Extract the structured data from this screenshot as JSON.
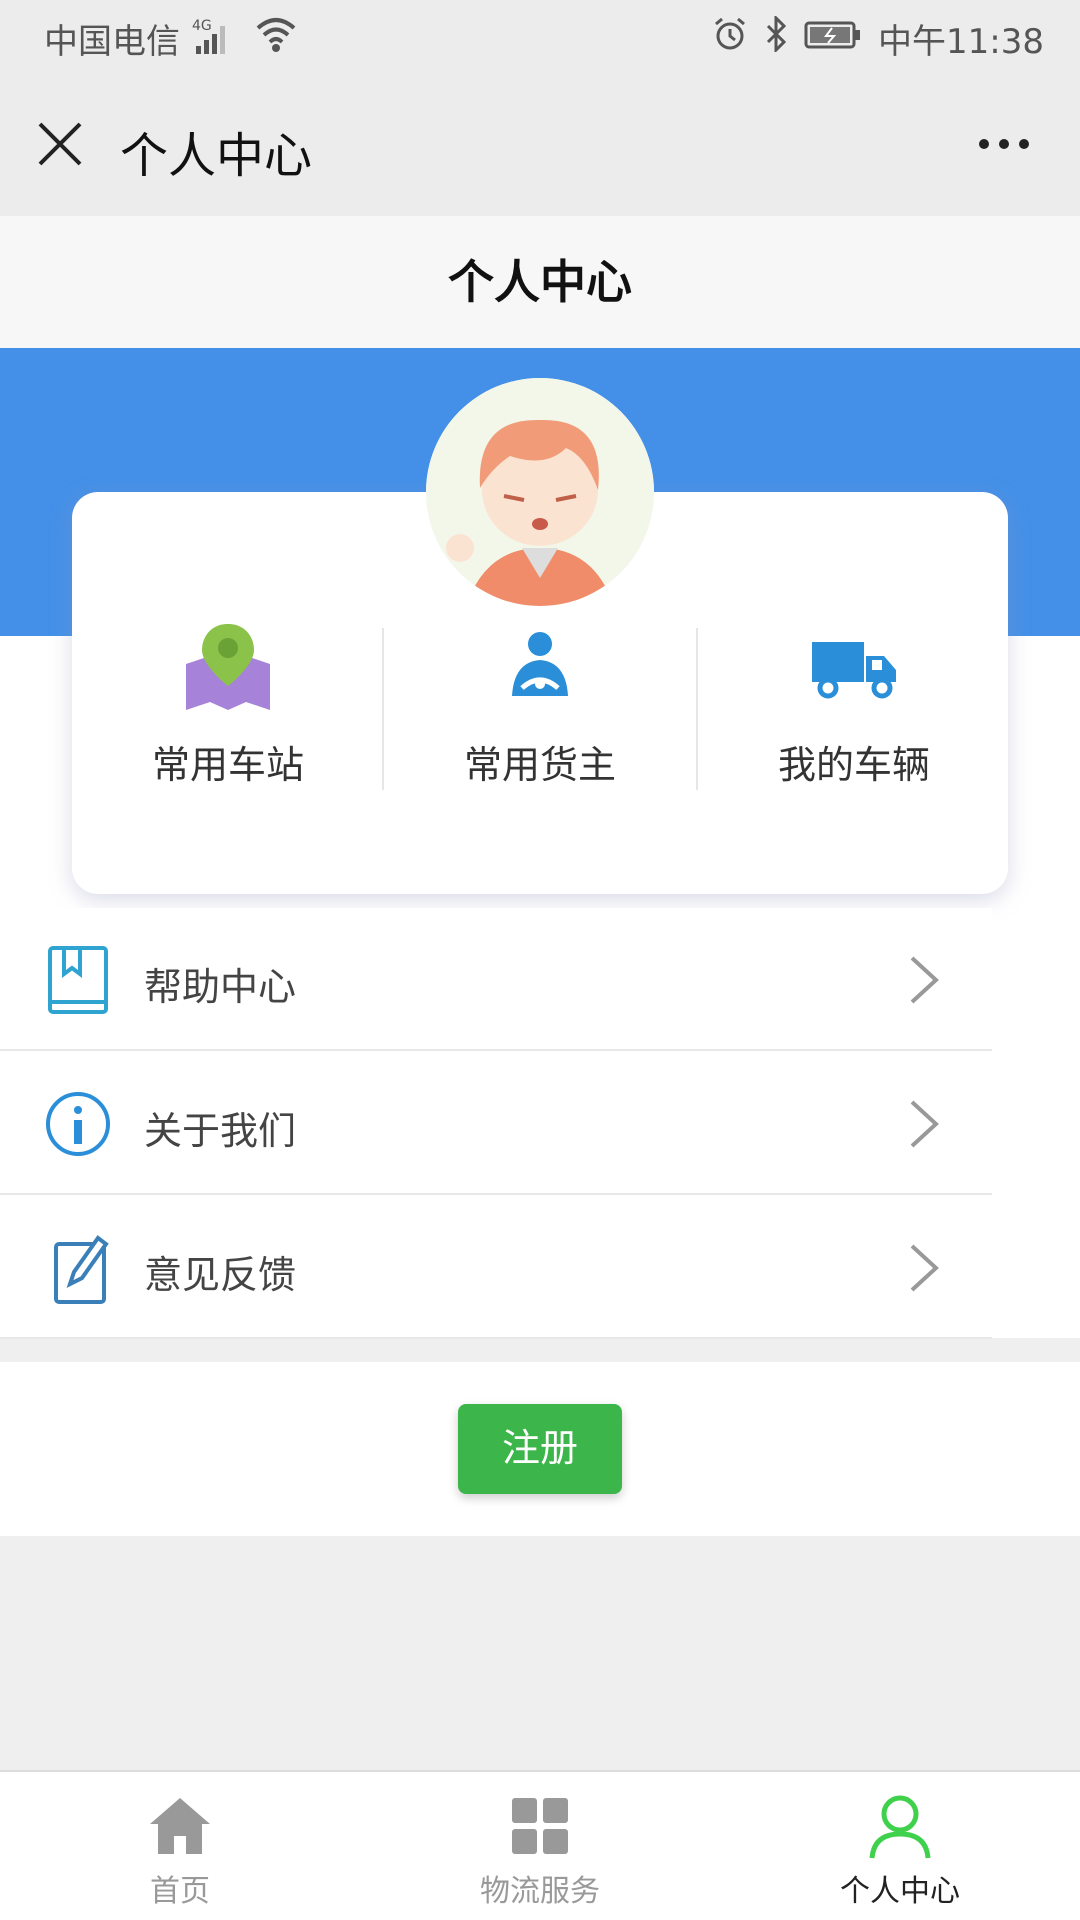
{
  "status_bar": {
    "carrier": "中国电信",
    "network": "4G",
    "time": "中午11:38"
  },
  "nav": {
    "title": "个人中心"
  },
  "header": {
    "title": "个人中心"
  },
  "shortcuts": [
    {
      "label": "常用车站",
      "icon": "map-pin-icon"
    },
    {
      "label": "常用货主",
      "icon": "driver-icon"
    },
    {
      "label": "我的车辆",
      "icon": "truck-icon"
    }
  ],
  "menu": [
    {
      "label": "帮助中心",
      "icon": "book-icon"
    },
    {
      "label": "关于我们",
      "icon": "info-icon"
    },
    {
      "label": "意见反馈",
      "icon": "edit-icon"
    }
  ],
  "register_label": "注册",
  "tabs": [
    {
      "label": "首页",
      "icon": "home-icon"
    },
    {
      "label": "物流服务",
      "icon": "grid-icon"
    },
    {
      "label": "个人中心",
      "icon": "user-icon"
    }
  ],
  "colors": {
    "blue": "#4490e8",
    "green": "#3cb64a",
    "active_tab": "#3fd14c",
    "icon_blue": "#2a8fd8"
  }
}
